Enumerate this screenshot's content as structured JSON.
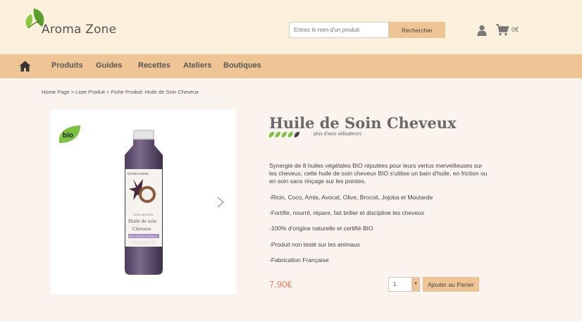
{
  "header": {
    "logo_text": "Aroma Zone",
    "search_placeholder": "Entrez le nom d'un produit",
    "search_button": "Rechercher",
    "cart_total": "0€",
    "icons": {
      "user": "user-icon",
      "cart": "cart-icon",
      "logo": "leaf-logo-icon"
    }
  },
  "nav": {
    "home_icon": "home-icon",
    "items": [
      "Produits",
      "Guides",
      "Recettes",
      "Ateliers",
      "Boutiques"
    ]
  },
  "breadcrumb": "Home Page > Liste Produit > Fiche Produit: Huile de Soin Cheveux",
  "product": {
    "badge": "bio",
    "title": "Huile de Soin Cheveux",
    "rating": {
      "value": 4.5,
      "max": 5
    },
    "reviews_label": "plus d'avis utilisateurs",
    "description": "Synergie de 8 huiles végétales BIO réputées pour leurs vertus merveilleuses sur les cheveux, cette huile de soin cheveux BIO s'utilise un bain d'huile, en friction ou en soin sans rinçage sur les pointes.",
    "bullets": [
      "-Ricin, Coco, Amla, Avocat, Olive, Brocoli, Jojoba et Moutarde",
      "-Fortifie, nourrit, répare, fait briller et discipline les cheveux",
      "-100% d'origine naturelle et certifié BIO",
      "-Produit non testé sur les animaux",
      "-Fabrication Française"
    ],
    "price": "7,90€",
    "quantity": "1",
    "add_to_cart": "Ajouter au Panier",
    "label_lines": [
      "AROMA-ZONE",
      "SOIN NATUREL",
      "Huile de soin",
      "Cheveux",
      "100% ORIGINE NATURELLE"
    ]
  },
  "colors": {
    "accent": "#f0c595",
    "header_bg": "#faf0dc",
    "page_bg": "#faf3ee",
    "price": "#e9835b",
    "green": "#7cc142"
  }
}
